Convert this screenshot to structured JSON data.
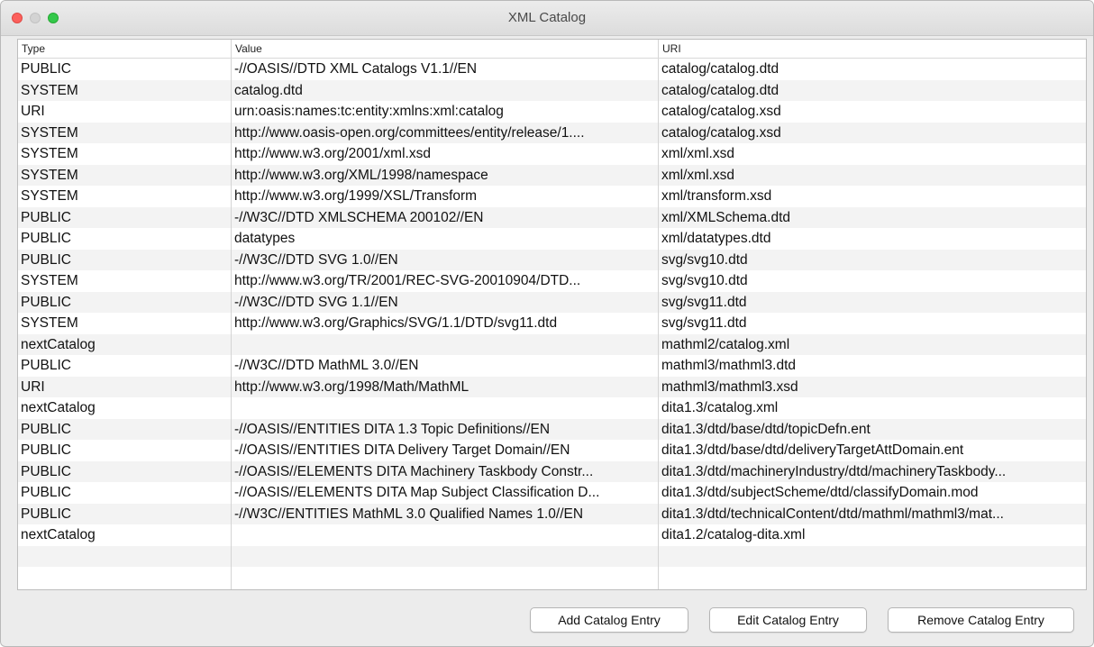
{
  "window": {
    "title": "XML Catalog"
  },
  "table": {
    "headers": [
      "Type",
      "Value",
      "URI"
    ],
    "rows": [
      [
        "PUBLIC",
        "-//OASIS//DTD XML Catalogs V1.1//EN",
        "catalog/catalog.dtd"
      ],
      [
        "SYSTEM",
        "catalog.dtd",
        "catalog/catalog.dtd"
      ],
      [
        "URI",
        "urn:oasis:names:tc:entity:xmlns:xml:catalog",
        "catalog/catalog.xsd"
      ],
      [
        "SYSTEM",
        "http://www.oasis-open.org/committees/entity/release/1....",
        "catalog/catalog.xsd"
      ],
      [
        "SYSTEM",
        "http://www.w3.org/2001/xml.xsd",
        "xml/xml.xsd"
      ],
      [
        "SYSTEM",
        "http://www.w3.org/XML/1998/namespace",
        "xml/xml.xsd"
      ],
      [
        "SYSTEM",
        "http://www.w3.org/1999/XSL/Transform",
        "xml/transform.xsd"
      ],
      [
        "PUBLIC",
        "-//W3C//DTD XMLSCHEMA 200102//EN",
        "xml/XMLSchema.dtd"
      ],
      [
        "PUBLIC",
        "datatypes",
        "xml/datatypes.dtd"
      ],
      [
        "PUBLIC",
        "-//W3C//DTD SVG 1.0//EN",
        "svg/svg10.dtd"
      ],
      [
        "SYSTEM",
        "http://www.w3.org/TR/2001/REC-SVG-20010904/DTD...",
        "svg/svg10.dtd"
      ],
      [
        "PUBLIC",
        "-//W3C//DTD SVG 1.1//EN",
        "svg/svg11.dtd"
      ],
      [
        "SYSTEM",
        "http://www.w3.org/Graphics/SVG/1.1/DTD/svg11.dtd",
        "svg/svg11.dtd"
      ],
      [
        "nextCatalog",
        "",
        "mathml2/catalog.xml"
      ],
      [
        "PUBLIC",
        "-//W3C//DTD MathML 3.0//EN",
        "mathml3/mathml3.dtd"
      ],
      [
        "URI",
        "http://www.w3.org/1998/Math/MathML",
        "mathml3/mathml3.xsd"
      ],
      [
        "nextCatalog",
        "",
        "dita1.3/catalog.xml"
      ],
      [
        "PUBLIC",
        "-//OASIS//ENTITIES DITA 1.3 Topic Definitions//EN",
        "dita1.3/dtd/base/dtd/topicDefn.ent"
      ],
      [
        "PUBLIC",
        "-//OASIS//ENTITIES DITA Delivery Target Domain//EN",
        "dita1.3/dtd/base/dtd/deliveryTargetAttDomain.ent"
      ],
      [
        "PUBLIC",
        "-//OASIS//ELEMENTS DITA Machinery Taskbody Constr...",
        "dita1.3/dtd/machineryIndustry/dtd/machineryTaskbody..."
      ],
      [
        "PUBLIC",
        "-//OASIS//ELEMENTS DITA Map Subject Classification D...",
        "dita1.3/dtd/subjectScheme/dtd/classifyDomain.mod"
      ],
      [
        "PUBLIC",
        "-//W3C//ENTITIES MathML 3.0 Qualified Names 1.0//EN",
        "dita1.3/dtd/technicalContent/dtd/mathml/mathml3/mat..."
      ],
      [
        "nextCatalog",
        "",
        "dita1.2/catalog-dita.xml"
      ],
      [
        "",
        "",
        ""
      ],
      [
        "",
        "",
        ""
      ]
    ]
  },
  "buttons": {
    "add": "Add Catalog Entry",
    "edit": "Edit Catalog Entry",
    "remove": "Remove Catalog Entry"
  }
}
